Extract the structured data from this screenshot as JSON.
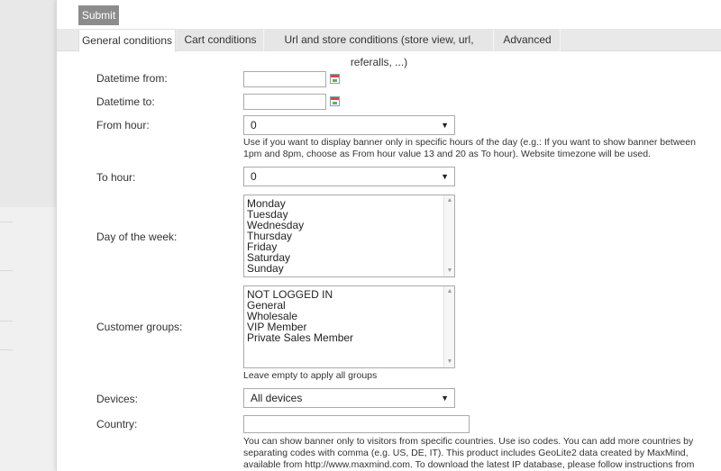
{
  "toolbar": {
    "submit_label": "Submit"
  },
  "tabs": [
    {
      "label": "General conditions",
      "active": true
    },
    {
      "label": "Cart conditions",
      "active": false
    },
    {
      "label": "Url and store conditions (store view, url, referalls, ...)",
      "active": false
    },
    {
      "label": "Advanced",
      "active": false
    }
  ],
  "form": {
    "datetime_from": {
      "label": "Datetime from:",
      "value": ""
    },
    "datetime_to": {
      "label": "Datetime to:",
      "value": ""
    },
    "from_hour": {
      "label": "From hour:",
      "value": "0",
      "note": "Use if you want to display banner only in specific hours of the day (e.g.: If you want to show banner between 1pm and 8pm, choose as From hour value 13 and 20 as To hour). Website timezone will be used."
    },
    "to_hour": {
      "label": "To hour:",
      "value": "0"
    },
    "day_of_week": {
      "label": "Day of the week:",
      "options": [
        "Monday",
        "Tuesday",
        "Wednesday",
        "Thursday",
        "Friday",
        "Saturday",
        "Sunday"
      ]
    },
    "customer_groups": {
      "label": "Customer groups:",
      "options": [
        "NOT LOGGED IN",
        "General",
        "Wholesale",
        "VIP Member",
        "Private Sales Member"
      ],
      "note": "Leave empty to apply all groups"
    },
    "devices": {
      "label": "Devices:",
      "value": "All devices"
    },
    "country": {
      "label": "Country:",
      "value": "",
      "note": "You can show banner only to visitors from specific countries. Use iso codes. You can add more countries by separating codes with comma (e.g. US, DE, IT). This product includes GeoLite2 data created by MaxMind, available from http://www.maxmind.com. To download the latest IP database, please follow instructions from our FAQ."
    }
  }
}
